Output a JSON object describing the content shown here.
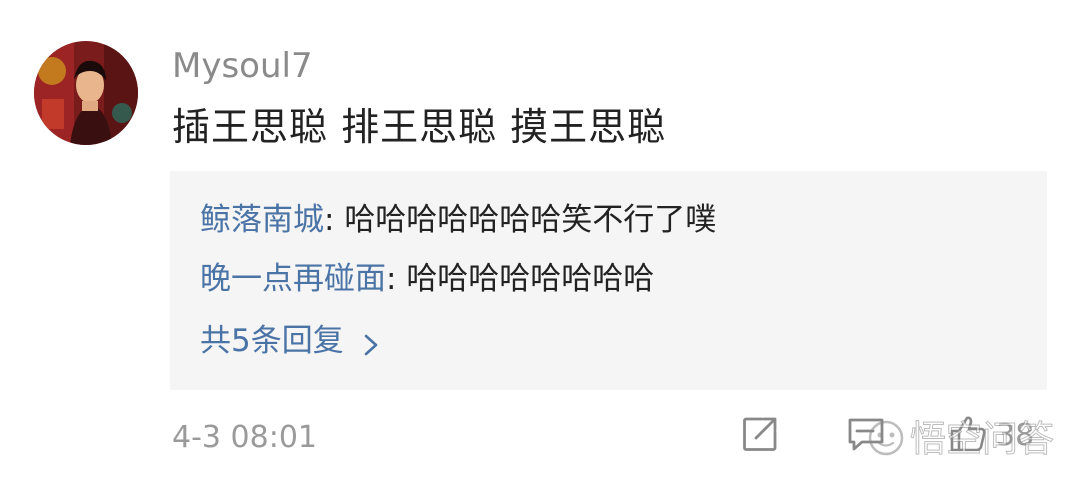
{
  "comment": {
    "username": "Mysoul7",
    "text": "插王思聪  排王思聪  摸王思聪",
    "timestamp": "4-3 08:01",
    "like_count": "38"
  },
  "replies": [
    {
      "author": "鲸落南城",
      "separator": ": ",
      "text": "哈哈哈哈哈哈哈笑不行了噗"
    },
    {
      "author": "晚一点再碰面",
      "separator": ": ",
      "text": "哈哈哈哈哈哈哈哈"
    }
  ],
  "more_replies_label": "共5条回复",
  "watermark": {
    "text": "悟空问答"
  },
  "icons": {
    "avatar": "avatar-illustration",
    "more_chevron": "chevron-right-icon",
    "share": "share-icon",
    "reply": "comment-icon",
    "like": "thumbs-up-icon",
    "watermark": "wukong-logo-icon"
  },
  "colors": {
    "username": "#8a8a8a",
    "text": "#222222",
    "link": "#4a73a6",
    "reply_box": "#f5f5f5",
    "meta": "#9a9a9a"
  }
}
